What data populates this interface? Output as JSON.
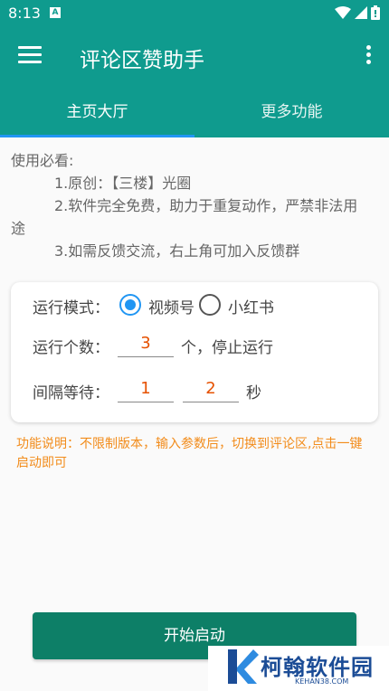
{
  "status_bar": {
    "time": "8:13",
    "notification_icon": "A",
    "icons": [
      "wifi-icon",
      "signal-icon",
      "battery-icon"
    ]
  },
  "app_bar": {
    "title": "评论区赞助手",
    "menu_icon": "hamburger-menu-icon",
    "more_icon": "more-vert-icon"
  },
  "tabs": [
    {
      "label": "主页大厅",
      "active": true
    },
    {
      "label": "更多功能",
      "active": false
    }
  ],
  "instructions": {
    "heading": "使用必看:",
    "line1": "1.原创：【三楼】光圈",
    "line2": "2.软件完全免费，助力于重复动作，严禁非法用",
    "line2_wrap": "途",
    "line3": "3.如需反馈交流，右上角可加入反馈群"
  },
  "settings": {
    "mode_label": "运行模式：",
    "mode_options": [
      {
        "label": "视频号",
        "checked": true
      },
      {
        "label": "小红书",
        "checked": false
      }
    ],
    "count_label": "运行个数：",
    "count_value": "3",
    "count_suffix": "个，停止运行",
    "interval_label": "间隔等待：",
    "interval_min": "1",
    "interval_max": "2",
    "interval_unit": "秒"
  },
  "function_note": "功能说明：不限制版本，输入参数后，切换到评论区,点击一键启动即可",
  "start_button": "开始启动",
  "watermark": {
    "text": "柯翰软件园",
    "sub": "KEHAN38.COM"
  },
  "colors": {
    "primary": "#0f9b8e",
    "button": "#0d7f67",
    "accent": "#2196f3",
    "note": "#f28c1b",
    "field_value": "#e65100"
  }
}
